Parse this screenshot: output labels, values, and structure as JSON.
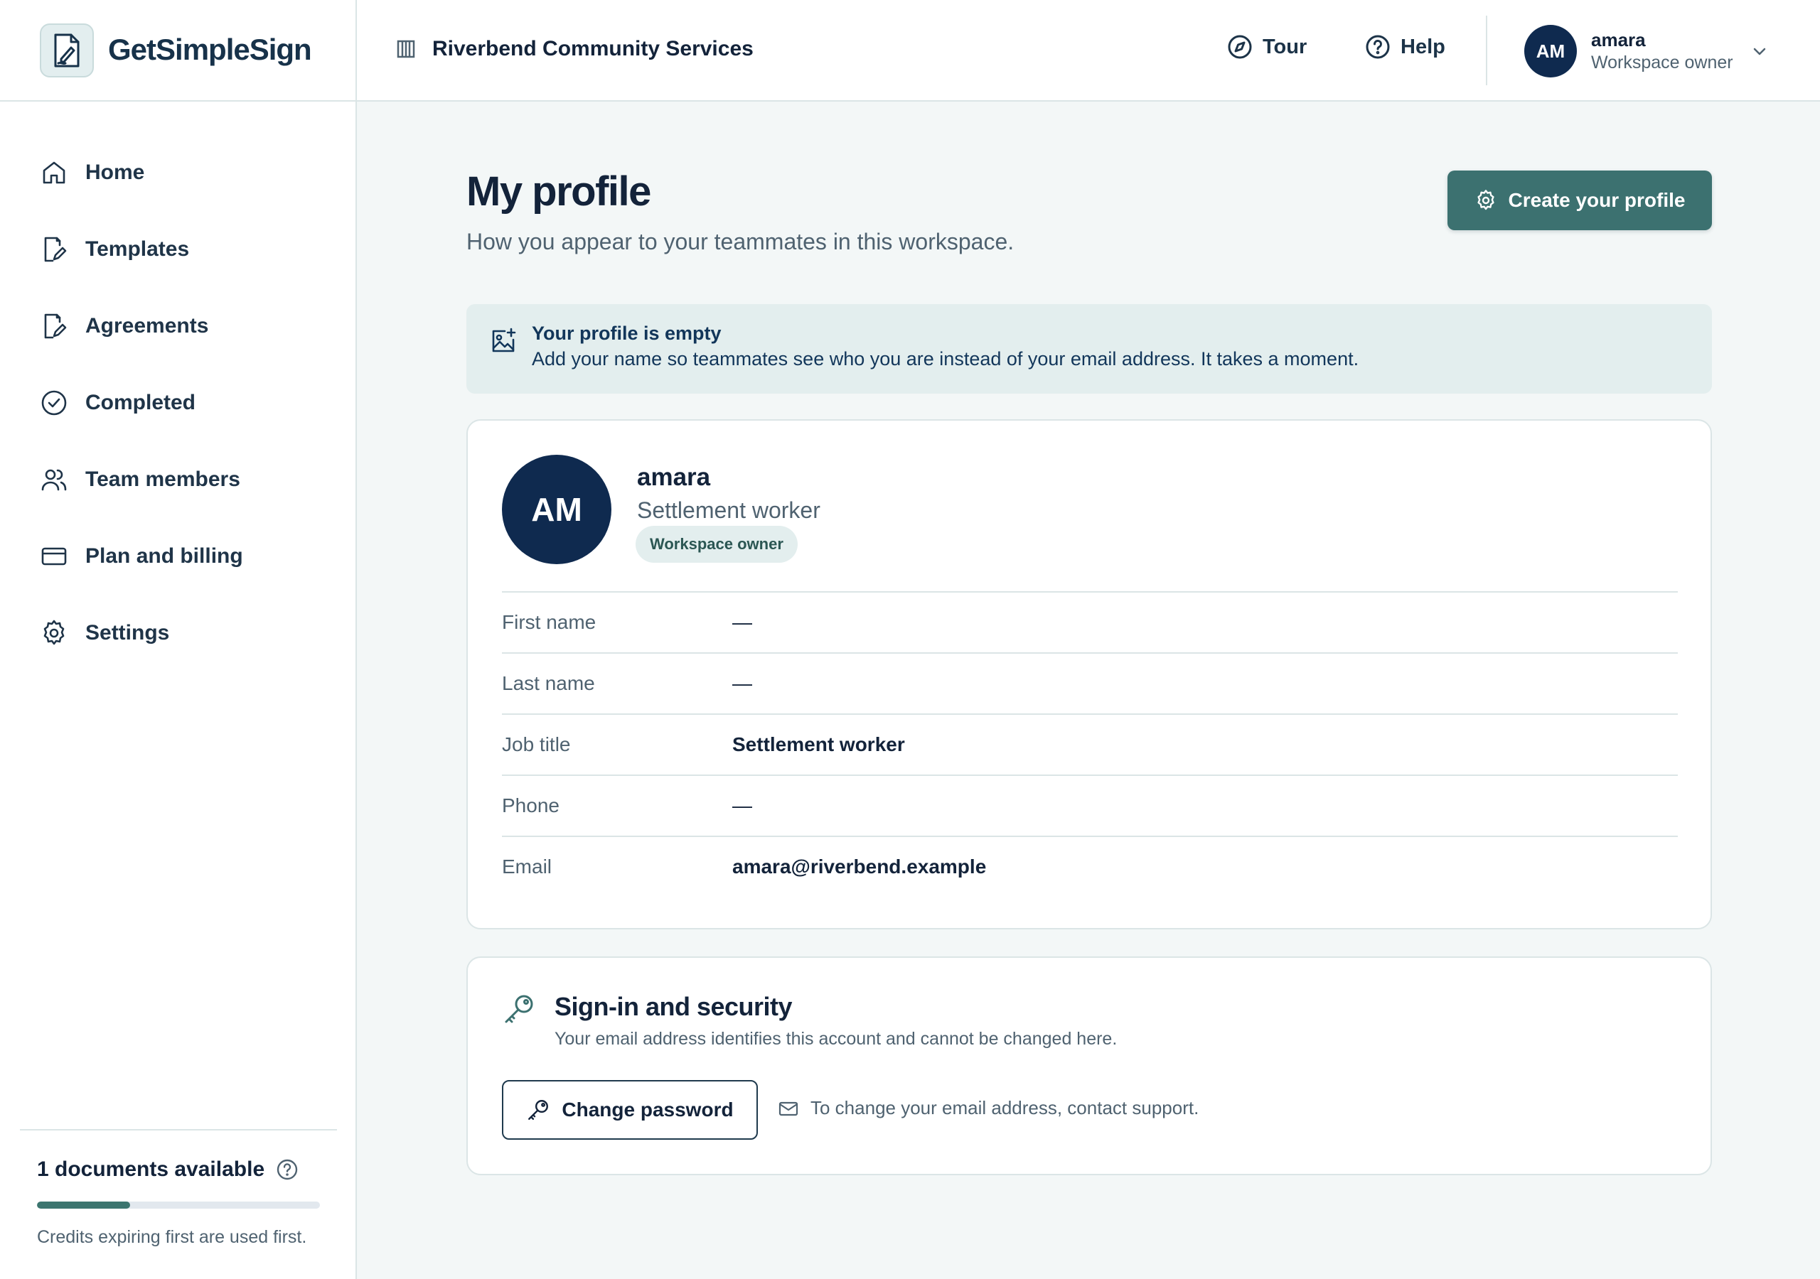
{
  "app": {
    "name": "GetSimpleSign",
    "organization": "Riverbend Community Services"
  },
  "header": {
    "tour_label": "Tour",
    "help_label": "Help",
    "user": {
      "initials": "AM",
      "name": "amara",
      "role": "Workspace owner"
    }
  },
  "sidebar": {
    "items": [
      {
        "label": "Home",
        "icon": "home-icon"
      },
      {
        "label": "Templates",
        "icon": "template-edit-icon"
      },
      {
        "label": "Agreements",
        "icon": "document-edit-icon"
      },
      {
        "label": "Completed",
        "icon": "check-circle-icon"
      },
      {
        "label": "Team members",
        "icon": "users-icon"
      },
      {
        "label": "Plan and billing",
        "icon": "credit-card-icon"
      },
      {
        "label": "Settings",
        "icon": "gear-icon"
      }
    ],
    "credits": {
      "label": "1 documents available",
      "progress_fraction": 0.33,
      "note": "Credits expiring first are used first."
    }
  },
  "main": {
    "title": "My profile",
    "subtitle": "How you appear to your teammates in this workspace.",
    "create_profile_label": "Create your profile",
    "banner": {
      "title": "Your profile is empty",
      "text": "Add your name so teammates see who you are instead of your email address. It takes a moment."
    },
    "profile": {
      "initials": "AM",
      "name": "amara",
      "job_title": "Settlement worker",
      "badge": "Workspace owner",
      "fields": [
        {
          "label": "First name",
          "value": "—"
        },
        {
          "label": "Last name",
          "value": "—"
        },
        {
          "label": "Job title",
          "value": "Settlement worker"
        },
        {
          "label": "Phone",
          "value": "—"
        },
        {
          "label": "Email",
          "value": "amara@riverbend.example"
        }
      ]
    },
    "security": {
      "title": "Sign-in and security",
      "subtitle": "Your email address identifies this account and cannot be changed here.",
      "change_password_label": "Change password",
      "support_note": "To change your email address, contact support."
    }
  },
  "colors": {
    "accent": "#3c7170",
    "avatar": "#0f2a4f",
    "banner_bg": "#e3eeee",
    "page_bg": "#f3f7f7"
  }
}
